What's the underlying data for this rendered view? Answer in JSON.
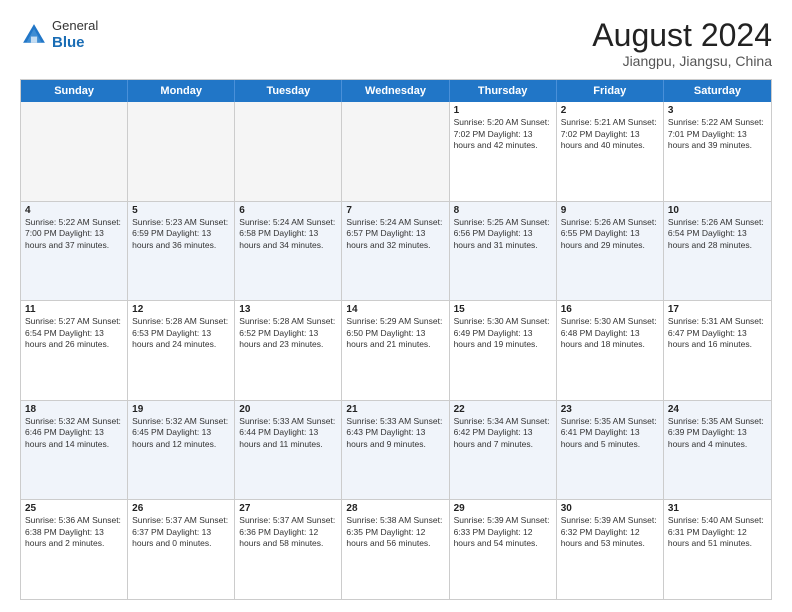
{
  "header": {
    "logo": {
      "general": "General",
      "blue": "Blue"
    },
    "title": "August 2024",
    "location": "Jiangpu, Jiangsu, China"
  },
  "days_of_week": [
    "Sunday",
    "Monday",
    "Tuesday",
    "Wednesday",
    "Thursday",
    "Friday",
    "Saturday"
  ],
  "weeks": [
    [
      {
        "day": "",
        "info": ""
      },
      {
        "day": "",
        "info": ""
      },
      {
        "day": "",
        "info": ""
      },
      {
        "day": "",
        "info": ""
      },
      {
        "day": "1",
        "info": "Sunrise: 5:20 AM\nSunset: 7:02 PM\nDaylight: 13 hours\nand 42 minutes."
      },
      {
        "day": "2",
        "info": "Sunrise: 5:21 AM\nSunset: 7:02 PM\nDaylight: 13 hours\nand 40 minutes."
      },
      {
        "day": "3",
        "info": "Sunrise: 5:22 AM\nSunset: 7:01 PM\nDaylight: 13 hours\nand 39 minutes."
      }
    ],
    [
      {
        "day": "4",
        "info": "Sunrise: 5:22 AM\nSunset: 7:00 PM\nDaylight: 13 hours\nand 37 minutes."
      },
      {
        "day": "5",
        "info": "Sunrise: 5:23 AM\nSunset: 6:59 PM\nDaylight: 13 hours\nand 36 minutes."
      },
      {
        "day": "6",
        "info": "Sunrise: 5:24 AM\nSunset: 6:58 PM\nDaylight: 13 hours\nand 34 minutes."
      },
      {
        "day": "7",
        "info": "Sunrise: 5:24 AM\nSunset: 6:57 PM\nDaylight: 13 hours\nand 32 minutes."
      },
      {
        "day": "8",
        "info": "Sunrise: 5:25 AM\nSunset: 6:56 PM\nDaylight: 13 hours\nand 31 minutes."
      },
      {
        "day": "9",
        "info": "Sunrise: 5:26 AM\nSunset: 6:55 PM\nDaylight: 13 hours\nand 29 minutes."
      },
      {
        "day": "10",
        "info": "Sunrise: 5:26 AM\nSunset: 6:54 PM\nDaylight: 13 hours\nand 28 minutes."
      }
    ],
    [
      {
        "day": "11",
        "info": "Sunrise: 5:27 AM\nSunset: 6:54 PM\nDaylight: 13 hours\nand 26 minutes."
      },
      {
        "day": "12",
        "info": "Sunrise: 5:28 AM\nSunset: 6:53 PM\nDaylight: 13 hours\nand 24 minutes."
      },
      {
        "day": "13",
        "info": "Sunrise: 5:28 AM\nSunset: 6:52 PM\nDaylight: 13 hours\nand 23 minutes."
      },
      {
        "day": "14",
        "info": "Sunrise: 5:29 AM\nSunset: 6:50 PM\nDaylight: 13 hours\nand 21 minutes."
      },
      {
        "day": "15",
        "info": "Sunrise: 5:30 AM\nSunset: 6:49 PM\nDaylight: 13 hours\nand 19 minutes."
      },
      {
        "day": "16",
        "info": "Sunrise: 5:30 AM\nSunset: 6:48 PM\nDaylight: 13 hours\nand 18 minutes."
      },
      {
        "day": "17",
        "info": "Sunrise: 5:31 AM\nSunset: 6:47 PM\nDaylight: 13 hours\nand 16 minutes."
      }
    ],
    [
      {
        "day": "18",
        "info": "Sunrise: 5:32 AM\nSunset: 6:46 PM\nDaylight: 13 hours\nand 14 minutes."
      },
      {
        "day": "19",
        "info": "Sunrise: 5:32 AM\nSunset: 6:45 PM\nDaylight: 13 hours\nand 12 minutes."
      },
      {
        "day": "20",
        "info": "Sunrise: 5:33 AM\nSunset: 6:44 PM\nDaylight: 13 hours\nand 11 minutes."
      },
      {
        "day": "21",
        "info": "Sunrise: 5:33 AM\nSunset: 6:43 PM\nDaylight: 13 hours\nand 9 minutes."
      },
      {
        "day": "22",
        "info": "Sunrise: 5:34 AM\nSunset: 6:42 PM\nDaylight: 13 hours\nand 7 minutes."
      },
      {
        "day": "23",
        "info": "Sunrise: 5:35 AM\nSunset: 6:41 PM\nDaylight: 13 hours\nand 5 minutes."
      },
      {
        "day": "24",
        "info": "Sunrise: 5:35 AM\nSunset: 6:39 PM\nDaylight: 13 hours\nand 4 minutes."
      }
    ],
    [
      {
        "day": "25",
        "info": "Sunrise: 5:36 AM\nSunset: 6:38 PM\nDaylight: 13 hours\nand 2 minutes."
      },
      {
        "day": "26",
        "info": "Sunrise: 5:37 AM\nSunset: 6:37 PM\nDaylight: 13 hours\nand 0 minutes."
      },
      {
        "day": "27",
        "info": "Sunrise: 5:37 AM\nSunset: 6:36 PM\nDaylight: 12 hours\nand 58 minutes."
      },
      {
        "day": "28",
        "info": "Sunrise: 5:38 AM\nSunset: 6:35 PM\nDaylight: 12 hours\nand 56 minutes."
      },
      {
        "day": "29",
        "info": "Sunrise: 5:39 AM\nSunset: 6:33 PM\nDaylight: 12 hours\nand 54 minutes."
      },
      {
        "day": "30",
        "info": "Sunrise: 5:39 AM\nSunset: 6:32 PM\nDaylight: 12 hours\nand 53 minutes."
      },
      {
        "day": "31",
        "info": "Sunrise: 5:40 AM\nSunset: 6:31 PM\nDaylight: 12 hours\nand 51 minutes."
      }
    ]
  ]
}
